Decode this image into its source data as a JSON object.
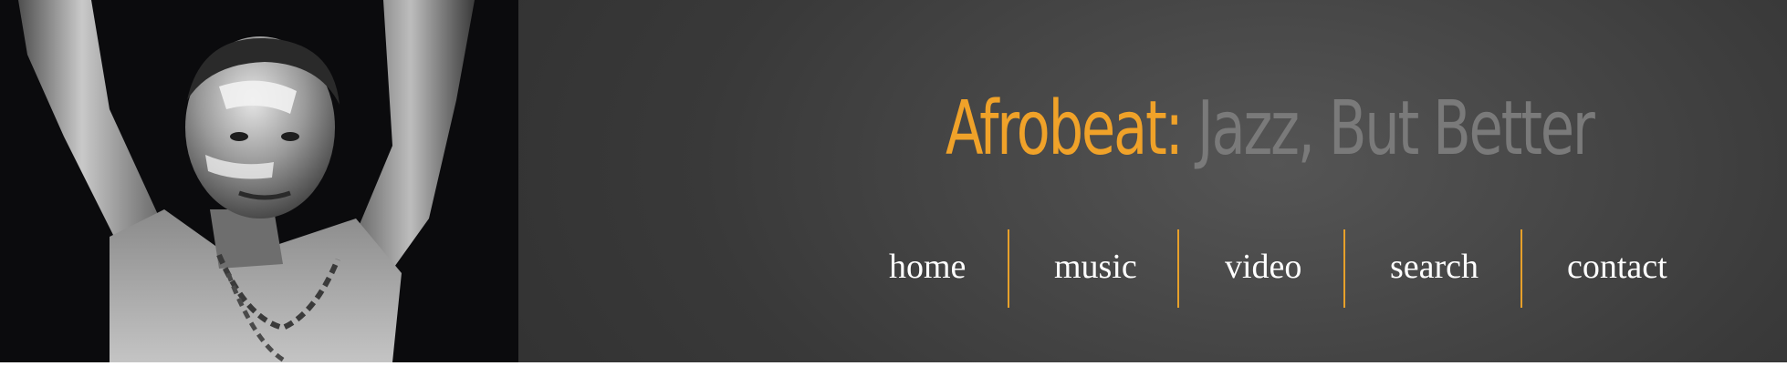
{
  "header": {
    "title_accent": "Afrobeat:",
    "title_rest": " Jazz, But Better",
    "accent_color": "#f0a229",
    "photo_description_icon": "performer-photo"
  },
  "nav": {
    "items": [
      {
        "label": "home"
      },
      {
        "label": "music"
      },
      {
        "label": "video"
      },
      {
        "label": "search"
      },
      {
        "label": "contact"
      }
    ],
    "separator_color": "#e7a02a"
  }
}
